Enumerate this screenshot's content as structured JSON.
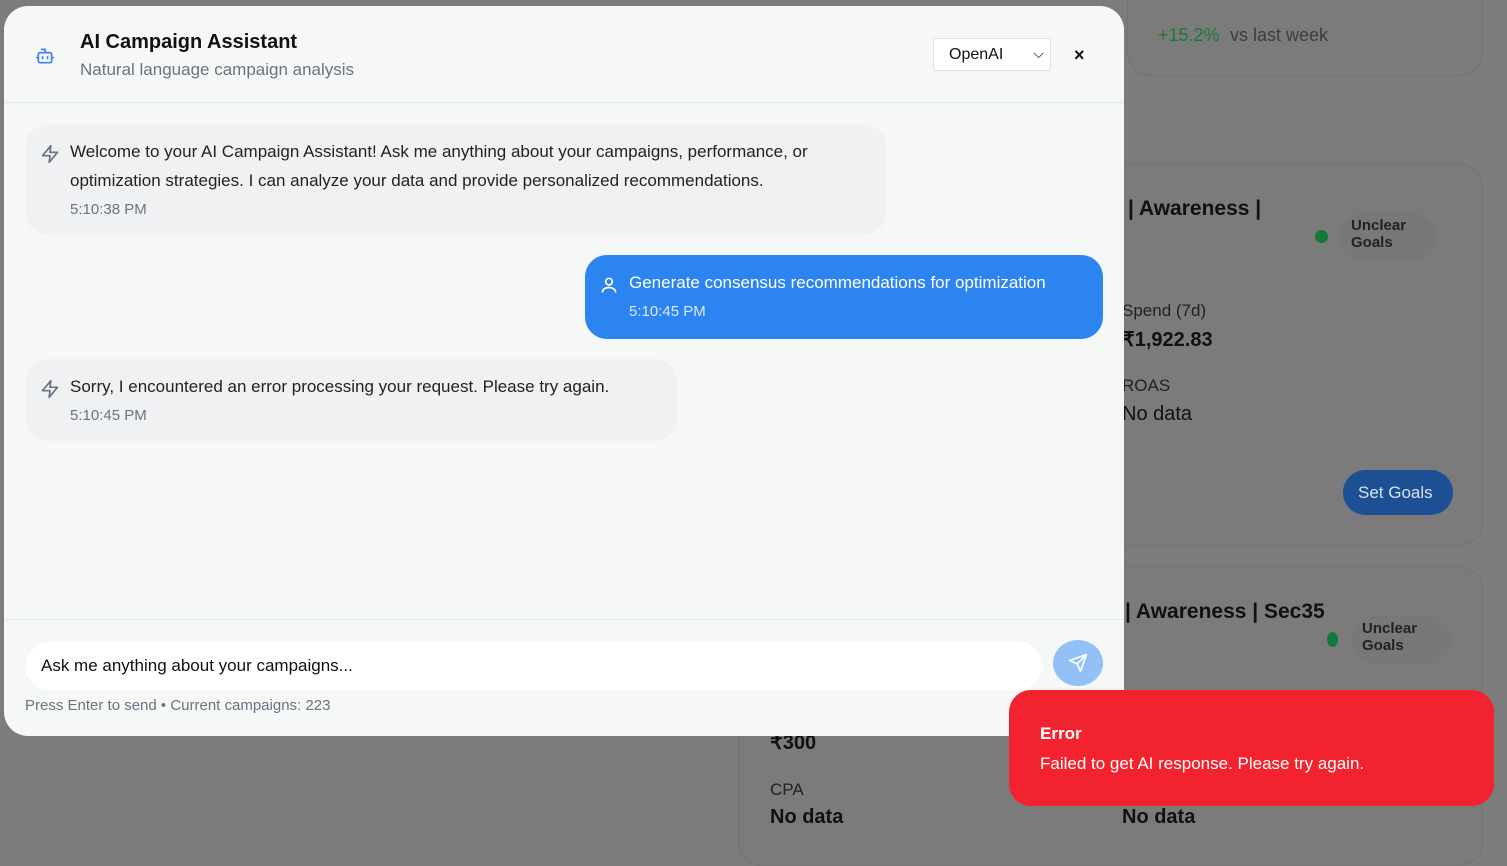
{
  "background": {
    "stat_change": "+15.2%",
    "stat_change_label": "vs last week",
    "card1": {
      "title": "| Awareness |",
      "status": "Unclear Goals",
      "spend_label": "Spend (7d)",
      "spend": "₹1,922.83",
      "roas_label": "ROAS",
      "roas": "No data",
      "button": "Set Goals"
    },
    "card2": {
      "title": "| Awareness | Sec35",
      "status": "Unclear Goals",
      "spend": "₹300",
      "cpa_label": "CPA",
      "cpa": "No data",
      "roas": "No data"
    }
  },
  "modal": {
    "title": "AI Campaign Assistant",
    "subtitle": "Natural language campaign analysis",
    "provider": "OpenAI",
    "close": "×",
    "messages": [
      {
        "role": "assistant",
        "text": "Welcome to your AI Campaign Assistant! Ask me anything about your campaigns, performance, or optimization strategies. I can analyze your data and provide personalized recommendations.",
        "time": "5:10:38 PM"
      },
      {
        "role": "user",
        "text": "Generate consensus recommendations for optimization",
        "time": "5:10:45 PM"
      },
      {
        "role": "assistant",
        "text": "Sorry, I encountered an error processing your request. Please try again.",
        "time": "5:10:45 PM"
      }
    ],
    "input_placeholder": "Ask me anything about your campaigns...",
    "hint": "Press Enter to send • Current campaigns: 223"
  },
  "toast": {
    "title": "Error",
    "message": "Failed to get AI response. Please try again."
  },
  "colors": {
    "accent": "#2c84f0",
    "error": "#f2222f",
    "positive": "#1a7a3a"
  }
}
